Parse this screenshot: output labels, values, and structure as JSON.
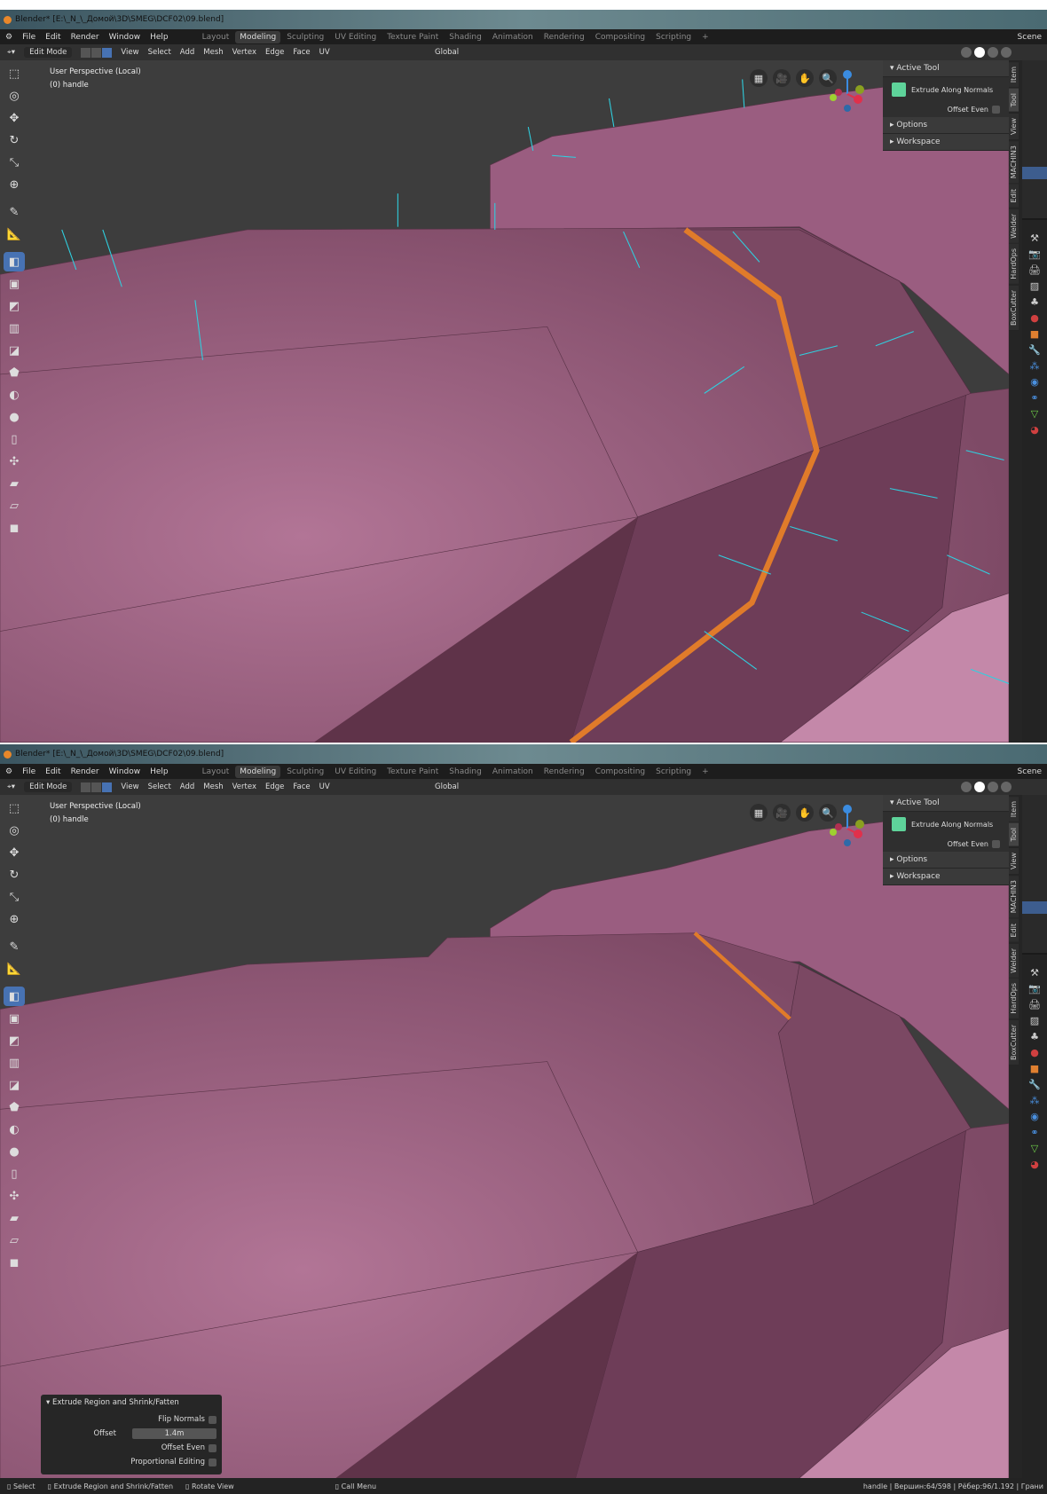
{
  "windows": [
    {
      "title": "Blender* [E:\\_N_\\_Домой\\3D\\SMEG\\DCF02\\09.blend]",
      "menu": [
        "File",
        "Edit",
        "Render",
        "Window",
        "Help"
      ],
      "workspaces": [
        "Layout",
        "Modeling",
        "Sculpting",
        "UV Editing",
        "Texture Paint",
        "Shading",
        "Animation",
        "Rendering",
        "Compositing",
        "Scripting",
        "+"
      ],
      "active_workspace": 1,
      "scene": "Scene",
      "mode": "Edit Mode",
      "header_menu": [
        "View",
        "Select",
        "Add",
        "Mesh",
        "Vertex",
        "Edge",
        "Face",
        "UV"
      ],
      "orientation": "Global",
      "viewport_label": "User Perspective (Local)",
      "object_label": "(0) handle",
      "npanel": {
        "active_tool": "Active Tool",
        "tool_name": "Extrude Along Normals",
        "offset_even": "Offset Even",
        "options": "Options",
        "workspace": "Workspace"
      },
      "tabs": [
        "Item",
        "Tool",
        "View",
        "MACHIN3",
        "Edit",
        "Welder",
        "HardOps",
        "BoxCutter"
      ],
      "show_normals": true
    },
    {
      "title": "Blender* [E:\\_N_\\_Домой\\3D\\SMEG\\DCF02\\09.blend]",
      "menu": [
        "File",
        "Edit",
        "Render",
        "Window",
        "Help"
      ],
      "workspaces": [
        "Layout",
        "Modeling",
        "Sculpting",
        "UV Editing",
        "Texture Paint",
        "Shading",
        "Animation",
        "Rendering",
        "Compositing",
        "Scripting",
        "+"
      ],
      "active_workspace": 1,
      "scene": "Scene",
      "mode": "Edit Mode",
      "header_menu": [
        "View",
        "Select",
        "Add",
        "Mesh",
        "Vertex",
        "Edge",
        "Face",
        "UV"
      ],
      "orientation": "Global",
      "viewport_label": "User Perspective (Local)",
      "object_label": "(0) handle",
      "npanel": {
        "active_tool": "Active Tool",
        "tool_name": "Extrude Along Normals",
        "offset_even": "Offset Even",
        "options": "Options",
        "workspace": "Workspace"
      },
      "tabs": [
        "Item",
        "Tool",
        "View",
        "MACHIN3",
        "Edit",
        "Welder",
        "HardOps",
        "BoxCutter"
      ],
      "show_normals": false,
      "operator_panel": {
        "title": "Extrude Region and Shrink/Fatten",
        "flip_normals": "Flip Normals",
        "offset_label": "Offset",
        "offset_value": "1.4m",
        "offset_even": "Offset Even",
        "proportional": "Proportional Editing"
      },
      "statusbar": {
        "items": [
          "Select",
          "Extrude Region and Shrink/Fatten",
          "Rotate View",
          "Call Menu"
        ],
        "stats": "handle | Вершин:64/598 | Рёбер:96/1.192 | Грани"
      }
    }
  ],
  "colors": {
    "accent": "#4772b3",
    "mesh": "#a86b8f",
    "selected_edge": "#e07b2a",
    "normals": "#2fd0e0"
  }
}
